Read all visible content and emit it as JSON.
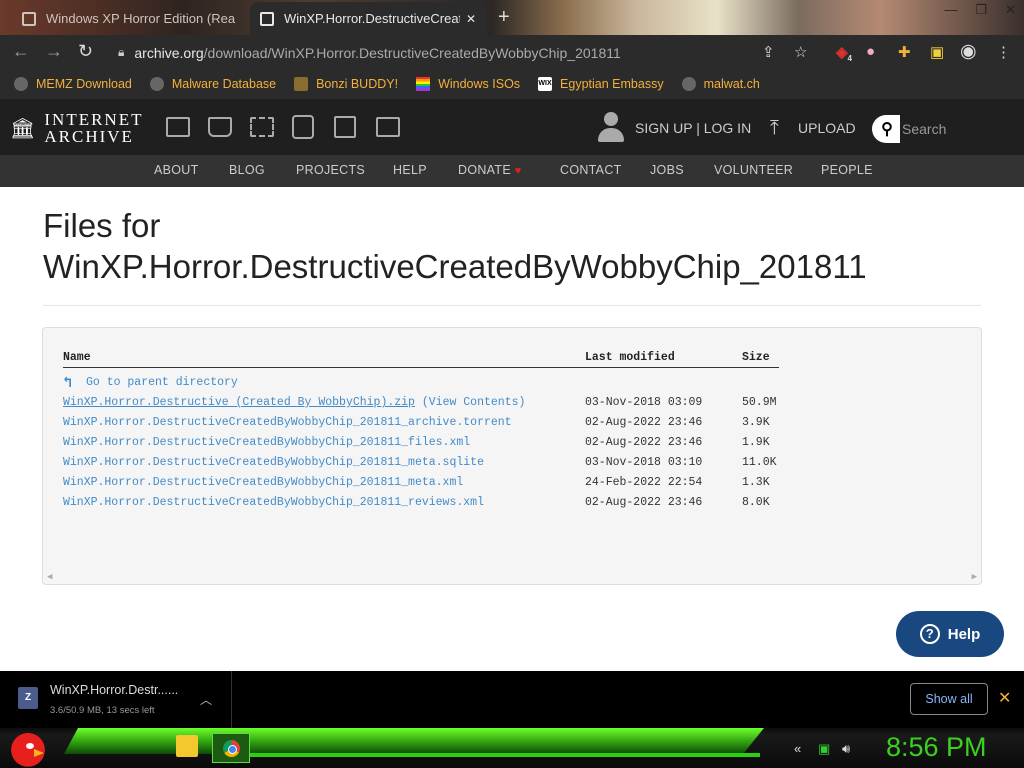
{
  "browser": {
    "tabs": [
      {
        "title": "Windows XP Horror Edition (Rea",
        "active": false
      },
      {
        "title": "WinXP.Horror.DestructiveCreated",
        "active": true
      }
    ],
    "url_domain": "archive.org",
    "url_path": "/download/WinXP.Horror.DestructiveCreatedByWobbyChip_201811",
    "bookmarks": [
      {
        "label": "MEMZ Download",
        "icon": "globe-icon"
      },
      {
        "label": "Malware Database",
        "icon": "globe-icon"
      },
      {
        "label": "Bonzi BUDDY!",
        "icon": "bonzi-icon"
      },
      {
        "label": "Windows ISOs",
        "icon": "rainbow-flag-icon"
      },
      {
        "label": "Egyptian Embassy",
        "icon": "wix-icon"
      },
      {
        "label": "malwat.ch",
        "icon": "globe-icon"
      }
    ],
    "extension_badge": "4"
  },
  "ia": {
    "logo_line1": "INTERNET",
    "logo_line2": "ARCHIVE",
    "signin": "SIGN UP | LOG IN",
    "upload": "UPLOAD",
    "search_placeholder": "Search",
    "nav": [
      {
        "label": "ABOUT"
      },
      {
        "label": "BLOG"
      },
      {
        "label": "PROJECTS"
      },
      {
        "label": "HELP"
      },
      {
        "label": "DONATE"
      },
      {
        "label": "CONTACT"
      },
      {
        "label": "JOBS"
      },
      {
        "label": "VOLUNTEER"
      },
      {
        "label": "PEOPLE"
      }
    ]
  },
  "page": {
    "title_line1": "Files for",
    "title_line2": "WinXP.Horror.DestructiveCreatedByWobbyChip_201811",
    "columns": {
      "name": "Name",
      "modified": "Last modified",
      "size": "Size"
    },
    "parent_link": "Go to parent directory",
    "files": [
      {
        "name": "WinXP.Horror.Destructive  (Created By WobbyChip).zip",
        "extra": "(View Contents)",
        "modified": "03-Nov-2018 03:09",
        "size": "50.9M"
      },
      {
        "name": "WinXP.Horror.DestructiveCreatedByWobbyChip_201811_archive.torrent",
        "extra": "",
        "modified": "02-Aug-2022 23:46",
        "size": "3.9K"
      },
      {
        "name": "WinXP.Horror.DestructiveCreatedByWobbyChip_201811_files.xml",
        "extra": "",
        "modified": "02-Aug-2022 23:46",
        "size": "1.9K"
      },
      {
        "name": "WinXP.Horror.DestructiveCreatedByWobbyChip_201811_meta.sqlite",
        "extra": "",
        "modified": "03-Nov-2018 03:10",
        "size": "11.0K"
      },
      {
        "name": "WinXP.Horror.DestructiveCreatedByWobbyChip_201811_meta.xml",
        "extra": "",
        "modified": "24-Feb-2022 22:54",
        "size": "1.3K"
      },
      {
        "name": "WinXP.Horror.DestructiveCreatedByWobbyChip_201811_reviews.xml",
        "extra": "",
        "modified": "02-Aug-2022 23:46",
        "size": "8.0K"
      }
    ],
    "help_button": "Help"
  },
  "download_bar": {
    "filename": "WinXP.Horror.Destr......",
    "status": "3.6/50.9 MB, 13 secs left",
    "show_all": "Show all"
  },
  "taskbar": {
    "clock": "8:56 PM"
  },
  "colors": {
    "link": "#428bca",
    "ia_header": "#1f1f1f",
    "ia_nav": "#333333",
    "bookmark_text": "#f2b13c",
    "clock": "#39d11e",
    "help_button": "#194880"
  }
}
